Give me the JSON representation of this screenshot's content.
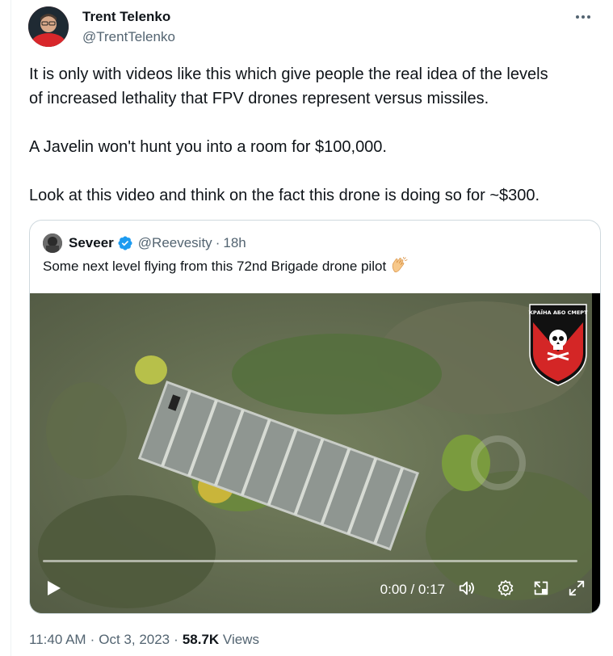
{
  "author": {
    "name": "Trent Telenko",
    "handle": "@TrentTelenko"
  },
  "tweet": {
    "paragraphs": [
      "It is only with videos like this which give people the real idea of the levels",
      "of increased lethality that FPV drones represent versus missiles.",
      "A Javelin won't hunt you into a room for $100,000.",
      "Look at this video and think on the fact this drone is doing so for ~$300."
    ]
  },
  "quoted": {
    "name": "Seveer",
    "handle": "@Reevesity",
    "separator": "·",
    "time": "18h",
    "text": "Some next level flying from this 72nd Brigade drone pilot",
    "emoji": "clapping-hands",
    "video": {
      "time_label": "0:00 / 0:17",
      "progress": 0,
      "shield_text": "УКРАЇНА АБО СМЕРТЬ"
    }
  },
  "meta": {
    "time": "11:40 AM",
    "separator": "·",
    "date": "Oct 3, 2023",
    "separator2": "·",
    "views_count": "58.7K",
    "views_label": "Views"
  },
  "colors": {
    "text": "#0f1419",
    "secondary": "#536471",
    "verified": "#1d9bf0",
    "border": "#cfd9de"
  }
}
